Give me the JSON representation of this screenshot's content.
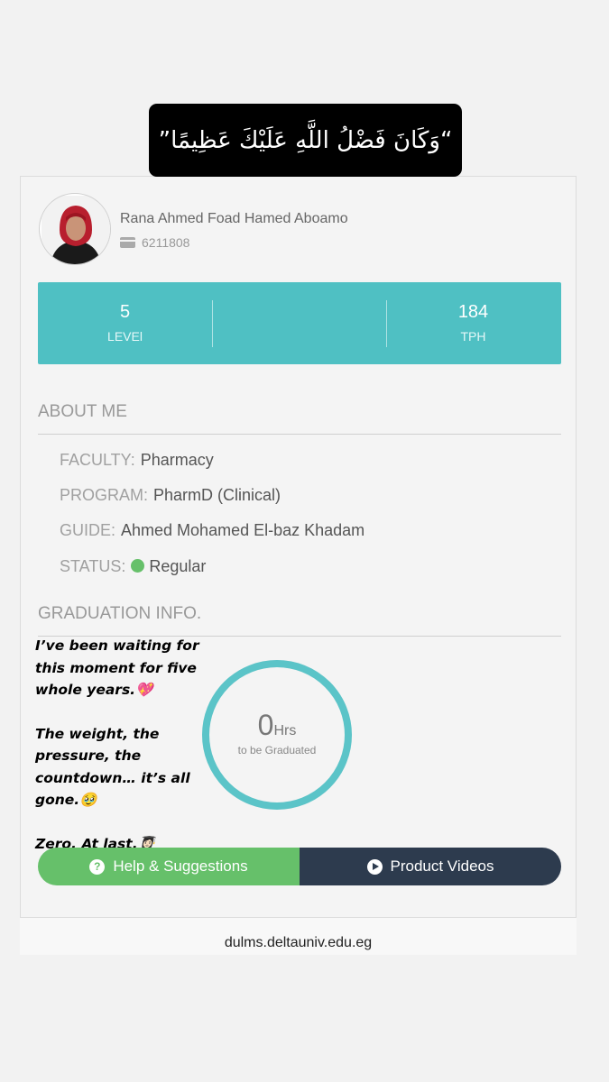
{
  "quote": {
    "text": "“وَكَانَ فَضْلُ اللَّهِ عَلَيْكَ عَظِيمًا”"
  },
  "profile": {
    "name": "Rana Ahmed Foad Hamed Aboamo",
    "id_icon": "id-card-icon",
    "id_number": "6211808"
  },
  "stats": [
    {
      "value": "5",
      "label": "LEVEl"
    },
    {
      "value": "",
      "label": ""
    },
    {
      "value": "184",
      "label": "TPH"
    }
  ],
  "about": {
    "title": "ABOUT ME",
    "faculty_label": "FACULTY:",
    "faculty_value": "Pharmacy",
    "program_label": "PROGRAM:",
    "program_value": "PharmD (Clinical)",
    "guide_label": "GUIDE:",
    "guide_value": "Ahmed Mohamed El-baz Khadam",
    "status_label": "STATUS:",
    "status_value": "Regular",
    "status_color": "#66c06a"
  },
  "graduation": {
    "title": "GRADUATION INFO.",
    "hours_value": "0",
    "hours_unit": "Hrs",
    "caption": "to be Graduated",
    "progress_fraction": 1.0,
    "ring_color": "#5bc4c8"
  },
  "story_caption": {
    "line1": "I’ve been waiting for this moment for five whole years.💖",
    "line2": "The weight, the pressure, the countdown… it’s all gone.🥹",
    "line3": "Zero. At last.👩🏻‍🎓"
  },
  "buttons": {
    "help_icon": "question-circle-icon",
    "help_icon_glyph": "?",
    "help_label": "Help & Suggestions",
    "videos_icon": "play-circle-icon",
    "videos_label": "Product Videos"
  },
  "footer": {
    "url": "dulms.deltauniv.edu.eg"
  },
  "colors": {
    "accent_teal": "#4fc0c3",
    "help_green": "#66c06a",
    "videos_navy": "#2d3b4e"
  }
}
